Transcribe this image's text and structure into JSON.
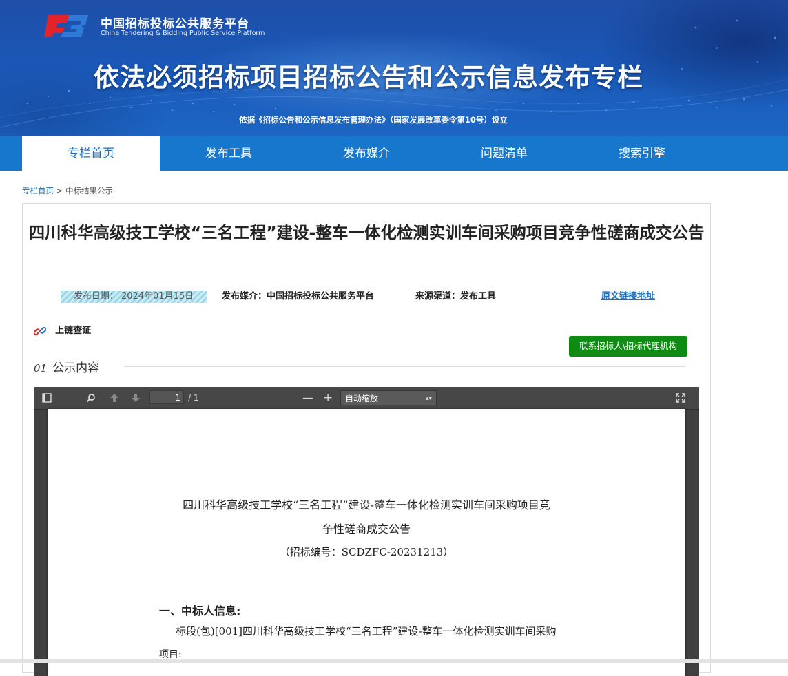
{
  "header": {
    "brand_cn": "中国招标投标公共服务平台",
    "brand_en": "China Tendering & Bidding Public Service Platform",
    "title": "依法必须招标项目招标公告和公示信息发布专栏",
    "subtitle": "依据《招标公告和公示信息发布管理办法》（国家发展改革委令第10号）设立"
  },
  "nav": {
    "items": [
      {
        "label": "专栏首页"
      },
      {
        "label": "发布工具"
      },
      {
        "label": "发布媒介"
      },
      {
        "label": "问题清单"
      },
      {
        "label": "搜索引擎"
      }
    ],
    "active_index": 0
  },
  "breadcrumb": {
    "home": "专栏首页",
    "separator": " > ",
    "current": "中标结果公示"
  },
  "article": {
    "title": "四川科华高级技工学校“三名工程”建设-整车一体化检测实训车间采购项目竞争性磋商成交公告",
    "publish_date": "发布日期：  2024年01月15日",
    "media": "发布媒介：中国招标投标公共服务平台",
    "channel": "来源渠道：发布工具",
    "source_link": "原文链接地址",
    "chain_label": "上链查证",
    "contact_button": "联系招标人\\招标代理机构",
    "section_num": "01",
    "section_label": "公示内容"
  },
  "viewer": {
    "page_current": "1",
    "page_total": "/ 1",
    "zoom_minus": "—",
    "zoom_plus": "+",
    "zoom_value": "自动缩放"
  },
  "document": {
    "title_line1": "四川科华高级技工学校“三名工程”建设-整车一体化检测实训车间采购项目竞",
    "title_line2": "争性磋商成交公告",
    "code": "（招标编号：SCDZFC-20231213）",
    "section1": "一、中标人信息:",
    "para1": "标段(包)[001]四川科华高级技工学校“三名工程”建设-整车一体化检测实训车间采购",
    "para2": "项目:"
  },
  "colors": {
    "banner": "#1a57b6",
    "nav": "#1677cc",
    "link": "#1b6fc0",
    "button_green": "#0f8a12",
    "viewer_bg": "#404040"
  }
}
